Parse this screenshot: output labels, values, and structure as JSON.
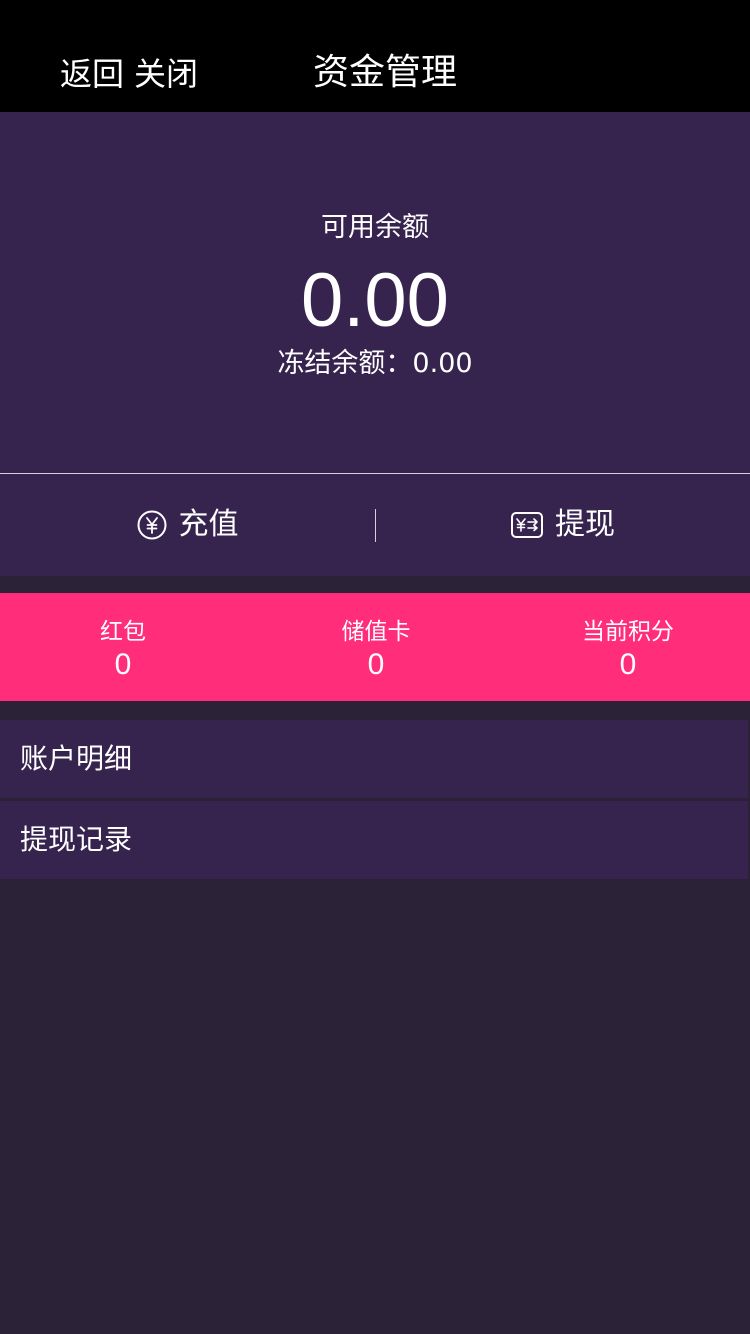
{
  "header": {
    "back_label": "返回",
    "close_label": "关闭",
    "title": "资金管理"
  },
  "balance": {
    "available_label": "可用余额",
    "available_amount": "0.00",
    "frozen_text": "冻结余额：0.00"
  },
  "actions": {
    "recharge_label": "充值",
    "recharge_icon": "yen-circle-icon",
    "withdraw_label": "提现",
    "withdraw_icon": "yen-transfer-icon"
  },
  "stats": [
    {
      "label": "红包",
      "value": "0"
    },
    {
      "label": "储值卡",
      "value": "0"
    },
    {
      "label": "当前积分",
      "value": "0"
    }
  ],
  "menu": [
    {
      "label": "账户明细"
    },
    {
      "label": "提现记录"
    }
  ],
  "colors": {
    "header_bg": "#000000",
    "panel_bg": "#36244f",
    "page_bg": "#2b2238",
    "accent_pink": "#ff2d7a",
    "text": "#ffffff"
  }
}
